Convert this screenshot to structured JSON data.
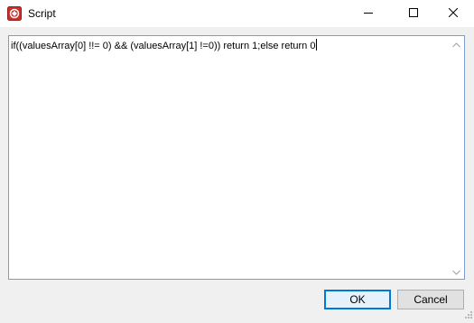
{
  "window": {
    "title": "Script",
    "icon": "app-icon",
    "controls": [
      "minimize-icon",
      "maximize-icon",
      "close-icon"
    ]
  },
  "editor": {
    "text": "if((valuesArray[0] !!= 0) && (valuesArray[1] !=0)) return 1;else return 0"
  },
  "buttons": {
    "ok_label": "OK",
    "cancel_label": "Cancel"
  },
  "colors": {
    "accent": "#0078d7",
    "app_icon": "#c8302c"
  }
}
